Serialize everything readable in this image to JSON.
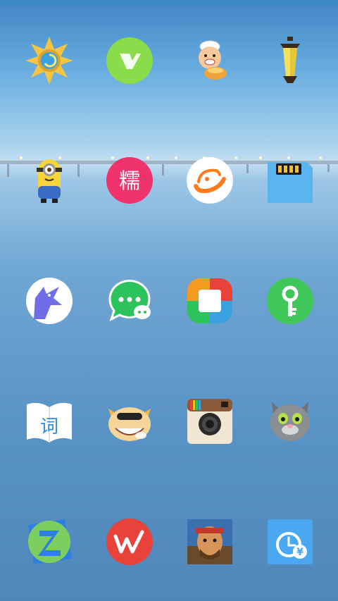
{
  "home_screen": {
    "wallpaper": "sea-bridge-wallpaper",
    "apps": [
      {
        "icon": "hearthstone-icon",
        "colors": {
          "bg": "#f4c542",
          "accent": "#3aa0e0"
        }
      },
      {
        "icon": "green-y-app-icon",
        "colors": {
          "bg": "#8bdc4a",
          "accent": "#ffffff"
        }
      },
      {
        "icon": "chef-cartoon-icon",
        "colors": {
          "bg": "#f2a23a"
        }
      },
      {
        "icon": "lantern-icon",
        "colors": {
          "bg": "#f3e25a",
          "accent": "#3a2a1a"
        }
      },
      {
        "icon": "minion-icon",
        "colors": {
          "bg": "#f6d43a",
          "accent": "#3b6cc4"
        }
      },
      {
        "icon": "nuo-app-icon",
        "label_char": "糯",
        "colors": {
          "bg": "#f0326e"
        }
      },
      {
        "icon": "alibaba-icon",
        "colors": {
          "bg": "#ffffff",
          "accent": "#ff7a1a"
        }
      },
      {
        "icon": "sd-card-icon",
        "colors": {
          "bg": "#5ab4ef",
          "accent": "#f7c21b"
        }
      },
      {
        "icon": "wolf-icon",
        "colors": {
          "bg": "#ffffff",
          "accent": "#6f6ee8"
        }
      },
      {
        "icon": "chat-bubble-icon",
        "colors": {
          "bg": "#ffffff",
          "accent": "#2cc35c"
        }
      },
      {
        "icon": "square-logo-icon",
        "colors": {
          "bg": "#ffffff",
          "accent": "#f59b20"
        }
      },
      {
        "icon": "key-icon",
        "colors": {
          "bg": "#3fc75a",
          "accent": "#ffffff"
        }
      },
      {
        "icon": "dictionary-icon",
        "label_char": "词",
        "colors": {
          "bg": "#ffffff",
          "accent": "#2d8be0"
        }
      },
      {
        "icon": "cow-cartoon-icon",
        "colors": {
          "bg": "#f5d59a"
        }
      },
      {
        "icon": "instagram-camera-icon",
        "colors": {
          "bg": "#efe6d4",
          "accent": "#8a5a3a"
        }
      },
      {
        "icon": "talking-tom-icon",
        "colors": {
          "bg": "#8a8f94"
        }
      },
      {
        "icon": "z-app-icon",
        "colors": {
          "bg": "#2d7fe0",
          "accent": "#8bdc4a"
        }
      },
      {
        "icon": "w-app-icon",
        "colors": {
          "bg": "#e8423a",
          "accent": "#ffffff"
        }
      },
      {
        "icon": "warrior-game-icon",
        "colors": {
          "bg": "#c0392b"
        }
      },
      {
        "icon": "clock-yen-icon",
        "label_char": "¥",
        "colors": {
          "bg": "#4aa8f0",
          "accent": "#ffffff"
        }
      }
    ]
  }
}
